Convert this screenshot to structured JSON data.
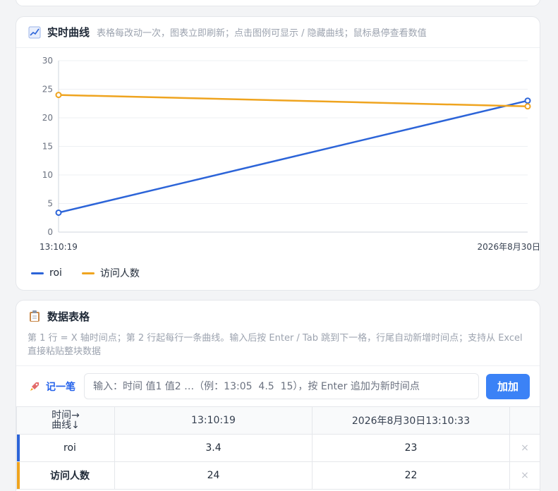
{
  "chart_section": {
    "icon": "chart-increasing-icon",
    "title": "实时曲线",
    "subtitle": "表格每改动一次，图表立即刷新；点击图例可显示 / 隐藏曲线；鼠标悬停查看数值"
  },
  "chart_data": {
    "type": "line",
    "x": [
      "13:10:19",
      "2026年8月30日"
    ],
    "series": [
      {
        "name": "roi",
        "values": [
          3.4,
          23
        ],
        "color": "#2c64d8"
      },
      {
        "name": "访问人数",
        "values": [
          24,
          22
        ],
        "color": "#efa41f"
      }
    ],
    "ylim": [
      0,
      30
    ],
    "yticks": [
      0,
      5,
      10,
      15,
      20,
      25,
      30
    ],
    "grid": true,
    "legend_position": "bottom-left"
  },
  "table_section": {
    "icon": "clipboard-icon",
    "title": "数据表格",
    "description": "第 1 行 = X 轴时间点；第 2 行起每行一条曲线。输入后按 Enter / Tab 跳到下一格，行尾自动新增时间点；支持从 Excel 直接粘贴整块数据",
    "quick_add": {
      "icon": "rocket-icon",
      "label": "记一笔",
      "placeholder": "输入：时间 值1 值2 …（例：13:05  4.5  15），按 Enter 追加为新时间点",
      "button": "加加"
    },
    "corner_header": "时间→\n曲线↓",
    "columns": [
      "13:10:19",
      "2026年8月30日13:10:33"
    ],
    "rows": [
      {
        "name": "roi",
        "values": [
          "3.4",
          "23"
        ],
        "color": "#2c64d8",
        "delete": "×"
      },
      {
        "name": "访问人数",
        "values": [
          "24",
          "22"
        ],
        "color": "#efa41f",
        "delete": "×"
      }
    ]
  }
}
